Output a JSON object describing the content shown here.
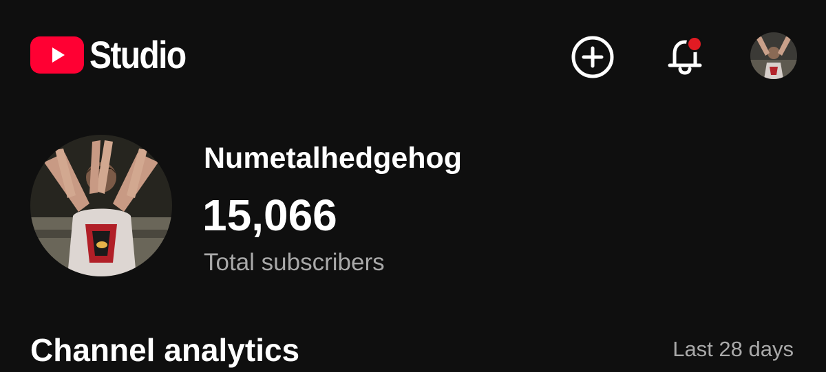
{
  "header": {
    "logo_text": "Studio",
    "icons": {
      "logo": "youtube-play-icon",
      "create": "plus-circle-icon",
      "notifications": "bell-icon",
      "account": "account-avatar"
    },
    "notification_dot": true
  },
  "channel": {
    "name": "Numetalhedgehog",
    "subscriber_count": "15,066",
    "subscriber_label": "Total subscribers"
  },
  "analytics": {
    "title": "Channel analytics",
    "range": "Last 28 days"
  },
  "colors": {
    "background": "#0f0f0f",
    "brand_red": "#ff0033",
    "text_primary": "#ffffff",
    "text_secondary": "#a9a9a9",
    "notification_dot": "#e21b23"
  }
}
